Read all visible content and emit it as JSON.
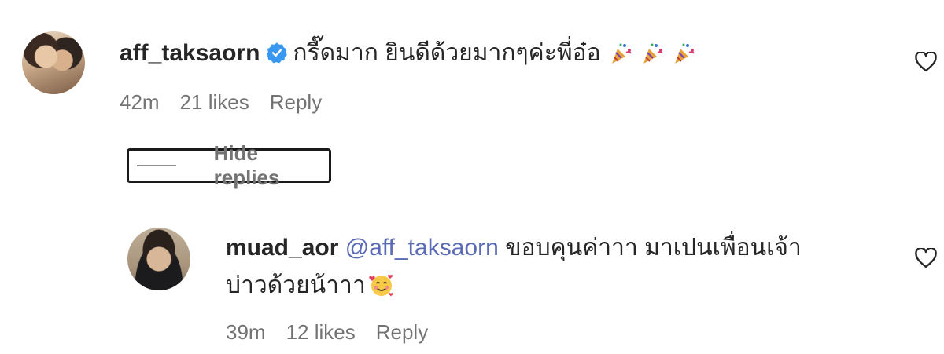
{
  "comments": [
    {
      "username": "aff_taksaorn",
      "verified": true,
      "text": "กรี๊ดมาก ยินดีด้วยมากๆค่ะพี่อ๋อ",
      "emojis": [
        "party-popper",
        "party-popper",
        "party-popper"
      ],
      "time": "42m",
      "likes": "21 likes",
      "reply_label": "Reply"
    },
    {
      "username": "muad_aor",
      "mention": "@aff_taksaorn",
      "text_line1": "ขอบคุนค่าาา มาเปนเพื่อนเจ้า",
      "text_line2": "บ่าวด้วยน้าาา",
      "emojis": [
        "smiling-face-with-hearts"
      ],
      "time": "39m",
      "likes": "12 likes",
      "reply_label": "Reply"
    }
  ],
  "replies_toggle": {
    "label": "Hide replies"
  },
  "icons": {
    "heart": "heart-outline-icon",
    "verified": "verified-badge-icon"
  },
  "colors": {
    "verified": "#3897f0",
    "mention": "#5b6bb5",
    "meta": "#737373"
  }
}
